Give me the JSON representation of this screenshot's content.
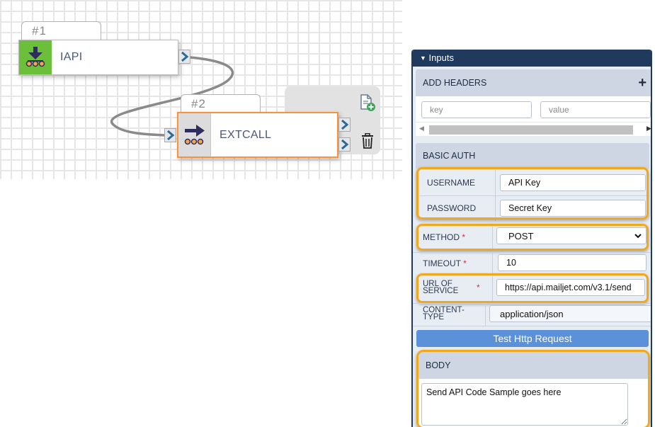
{
  "canvas": {
    "nodes": [
      {
        "number": "#1",
        "label": "IAPI",
        "icon": "download-arrow-icon",
        "icon_bg": "#6cbf3a",
        "selected": false
      },
      {
        "number": "#2",
        "label": "EXTCALL",
        "icon": "right-arrow-icon",
        "icon_bg": "#dcdcdc",
        "selected": true
      }
    ],
    "actions": [
      {
        "name": "add-document-icon"
      },
      {
        "name": "trash-icon"
      }
    ],
    "connection": {
      "from": "#1",
      "to": "#2"
    }
  },
  "panel": {
    "title": "Inputs",
    "add_headers": {
      "title": "ADD HEADERS",
      "add_icon": "plus-icon",
      "key_placeholder": "key",
      "value_placeholder": "value"
    },
    "basic_auth": {
      "title": "BASIC AUTH",
      "username_label": "USERNAME",
      "username_value": "API Key",
      "password_label": "PASSWORD",
      "password_value": "Secret Key"
    },
    "method": {
      "label": "METHOD",
      "required": "*",
      "value": "POST",
      "options": [
        "POST"
      ]
    },
    "timeout": {
      "label": "TIMEOUT",
      "required": "*",
      "value": "10"
    },
    "url": {
      "label_line1": "URL OF",
      "label_line2": "SERVICE",
      "required": "*",
      "value": "https://api.mailjet.com/v3.1/send"
    },
    "content_type": {
      "label_line1": "CONTENT-",
      "label_line2": "TYPE",
      "value": "application/json"
    },
    "test_button": "Test Http Request",
    "body": {
      "title": "BODY",
      "value": "Send API Code Sample goes here"
    }
  },
  "colors": {
    "panel_header": "#1f3a5c",
    "highlight": "#f2a81d",
    "selected_node": "#f7943a",
    "button": "#5b91d9",
    "required": "#e0263c"
  }
}
